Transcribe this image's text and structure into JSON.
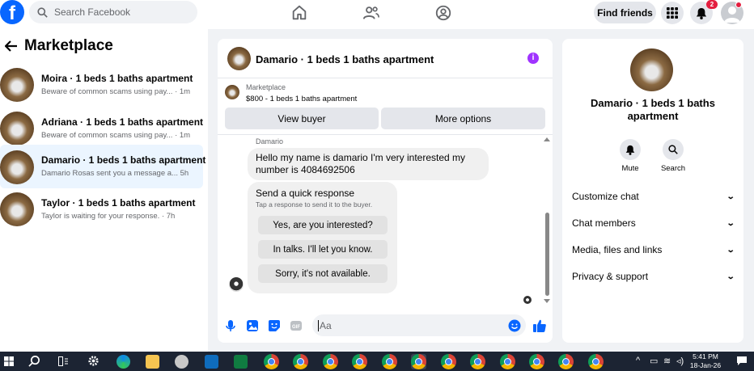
{
  "header": {
    "logo": "f",
    "search_placeholder": "Search Facebook",
    "nav_icons": [
      "home-icon",
      "friends-icon",
      "groups-icon"
    ],
    "find_friends_label": "Find friends",
    "notification_count": "2"
  },
  "sidebar": {
    "title": "Marketplace",
    "conversations": [
      {
        "title": "Moira · 1 beds 1 baths apartment",
        "preview": "Beware of common scams using pay...",
        "time": "· 1m",
        "active": false
      },
      {
        "title": "Adriana · 1 beds 1 baths apartment",
        "preview": "Beware of common scams using pay...",
        "time": "· 1m",
        "active": false
      },
      {
        "title": "Damario · 1 beds 1 baths apartment",
        "preview": "Damario Rosas sent you a message a...",
        "time": "5h",
        "active": true
      },
      {
        "title": "Taylor · 1 beds 1 baths apartment",
        "preview": "Taylor is waiting for your response.",
        "time": "· 7h",
        "active": false
      }
    ]
  },
  "chat": {
    "title": "Damario · 1 beds 1 baths apartment",
    "marketplace_label": "Marketplace",
    "listing": "$800 - 1 beds 1 baths apartment",
    "view_buyer_label": "View buyer",
    "more_options_label": "More options",
    "sender_name": "Damario",
    "message": "Hello my name is damario I'm very interested my number is 4084692506",
    "quick_response_title": "Send a quick response",
    "quick_response_subtitle": "Tap a response to send it to the buyer.",
    "quick_responses": [
      "Yes, are you interested?",
      "In talks. I'll let you know.",
      "Sorry, it's not available."
    ],
    "input_placeholder": "Aa"
  },
  "info_panel": {
    "title": "Damario · 1 beds 1 baths apartment",
    "mute_label": "Mute",
    "search_label": "Search",
    "menu": [
      "Customize chat",
      "Chat members",
      "Media, files and links",
      "Privacy & support"
    ]
  },
  "taskbar": {
    "time": "5:41 PM",
    "date": "18-Jan-26"
  },
  "colors": {
    "brand": "#0866ff",
    "active_row": "#ebf5ff",
    "badge": "#e41e3f",
    "info": "#a033ff"
  }
}
